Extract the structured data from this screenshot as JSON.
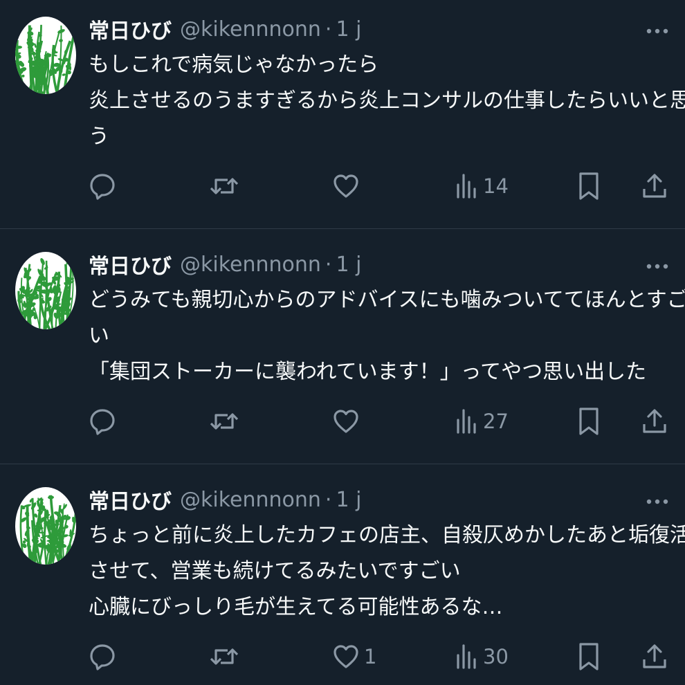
{
  "tweets": [
    {
      "author": {
        "name": "常日ひび",
        "handle": "@kikennnonn",
        "time": "1 j"
      },
      "lines": [
        "もしこれで病気じゃなかったら",
        "炎上させるのうますぎるから炎上コンサルの仕事したらいいと思",
        "う"
      ],
      "counts": {
        "replies": "",
        "retweets": "",
        "likes": "",
        "views": "14"
      }
    },
    {
      "author": {
        "name": "常日ひび",
        "handle": "@kikennnonn",
        "time": "1 j"
      },
      "lines": [
        "どうみても親切心からのアドバイスにも噛みついててほんとすご",
        "い",
        "「集団ストーカーに襲われています！」ってやつ思い出した"
      ],
      "counts": {
        "replies": "",
        "retweets": "",
        "likes": "",
        "views": "27"
      }
    },
    {
      "author": {
        "name": "常日ひび",
        "handle": "@kikennnonn",
        "time": "1 j"
      },
      "lines": [
        "ちょっと前に炎上したカフェの店主、自殺仄めかしたあと垢復活",
        "させて、営業も続けてるみたいですごい",
        "心臓にびっしり毛が生えてる可能性あるな…"
      ],
      "counts": {
        "replies": "",
        "retweets": "",
        "likes": "1",
        "views": "30"
      }
    }
  ],
  "icons": {
    "reply": "speech-bubble",
    "retweet": "retweet-arrows",
    "like": "heart",
    "views": "bar-chart",
    "bookmark": "bookmark",
    "share": "share-upload",
    "more": "three-dots"
  },
  "colors": {
    "background": "#15202b",
    "text": "#f7f9f9",
    "secondary": "#8b98a5",
    "divider": "#2f3b47",
    "avatar_plant": "#2e9b3a"
  }
}
